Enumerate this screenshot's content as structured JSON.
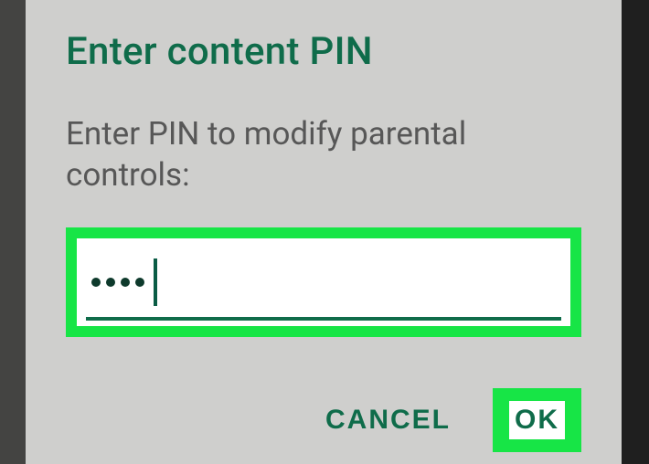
{
  "dialog": {
    "title": "Enter content PIN",
    "message": "Enter PIN to modify parental controls:",
    "pin_value": "••••",
    "pin_dot_count": 4,
    "buttons": {
      "cancel": "CANCEL",
      "ok": "OK"
    }
  },
  "colors": {
    "accent": "#0f6c4a",
    "highlight": "#17e546",
    "dialog_bg": "#cfcfcd"
  }
}
